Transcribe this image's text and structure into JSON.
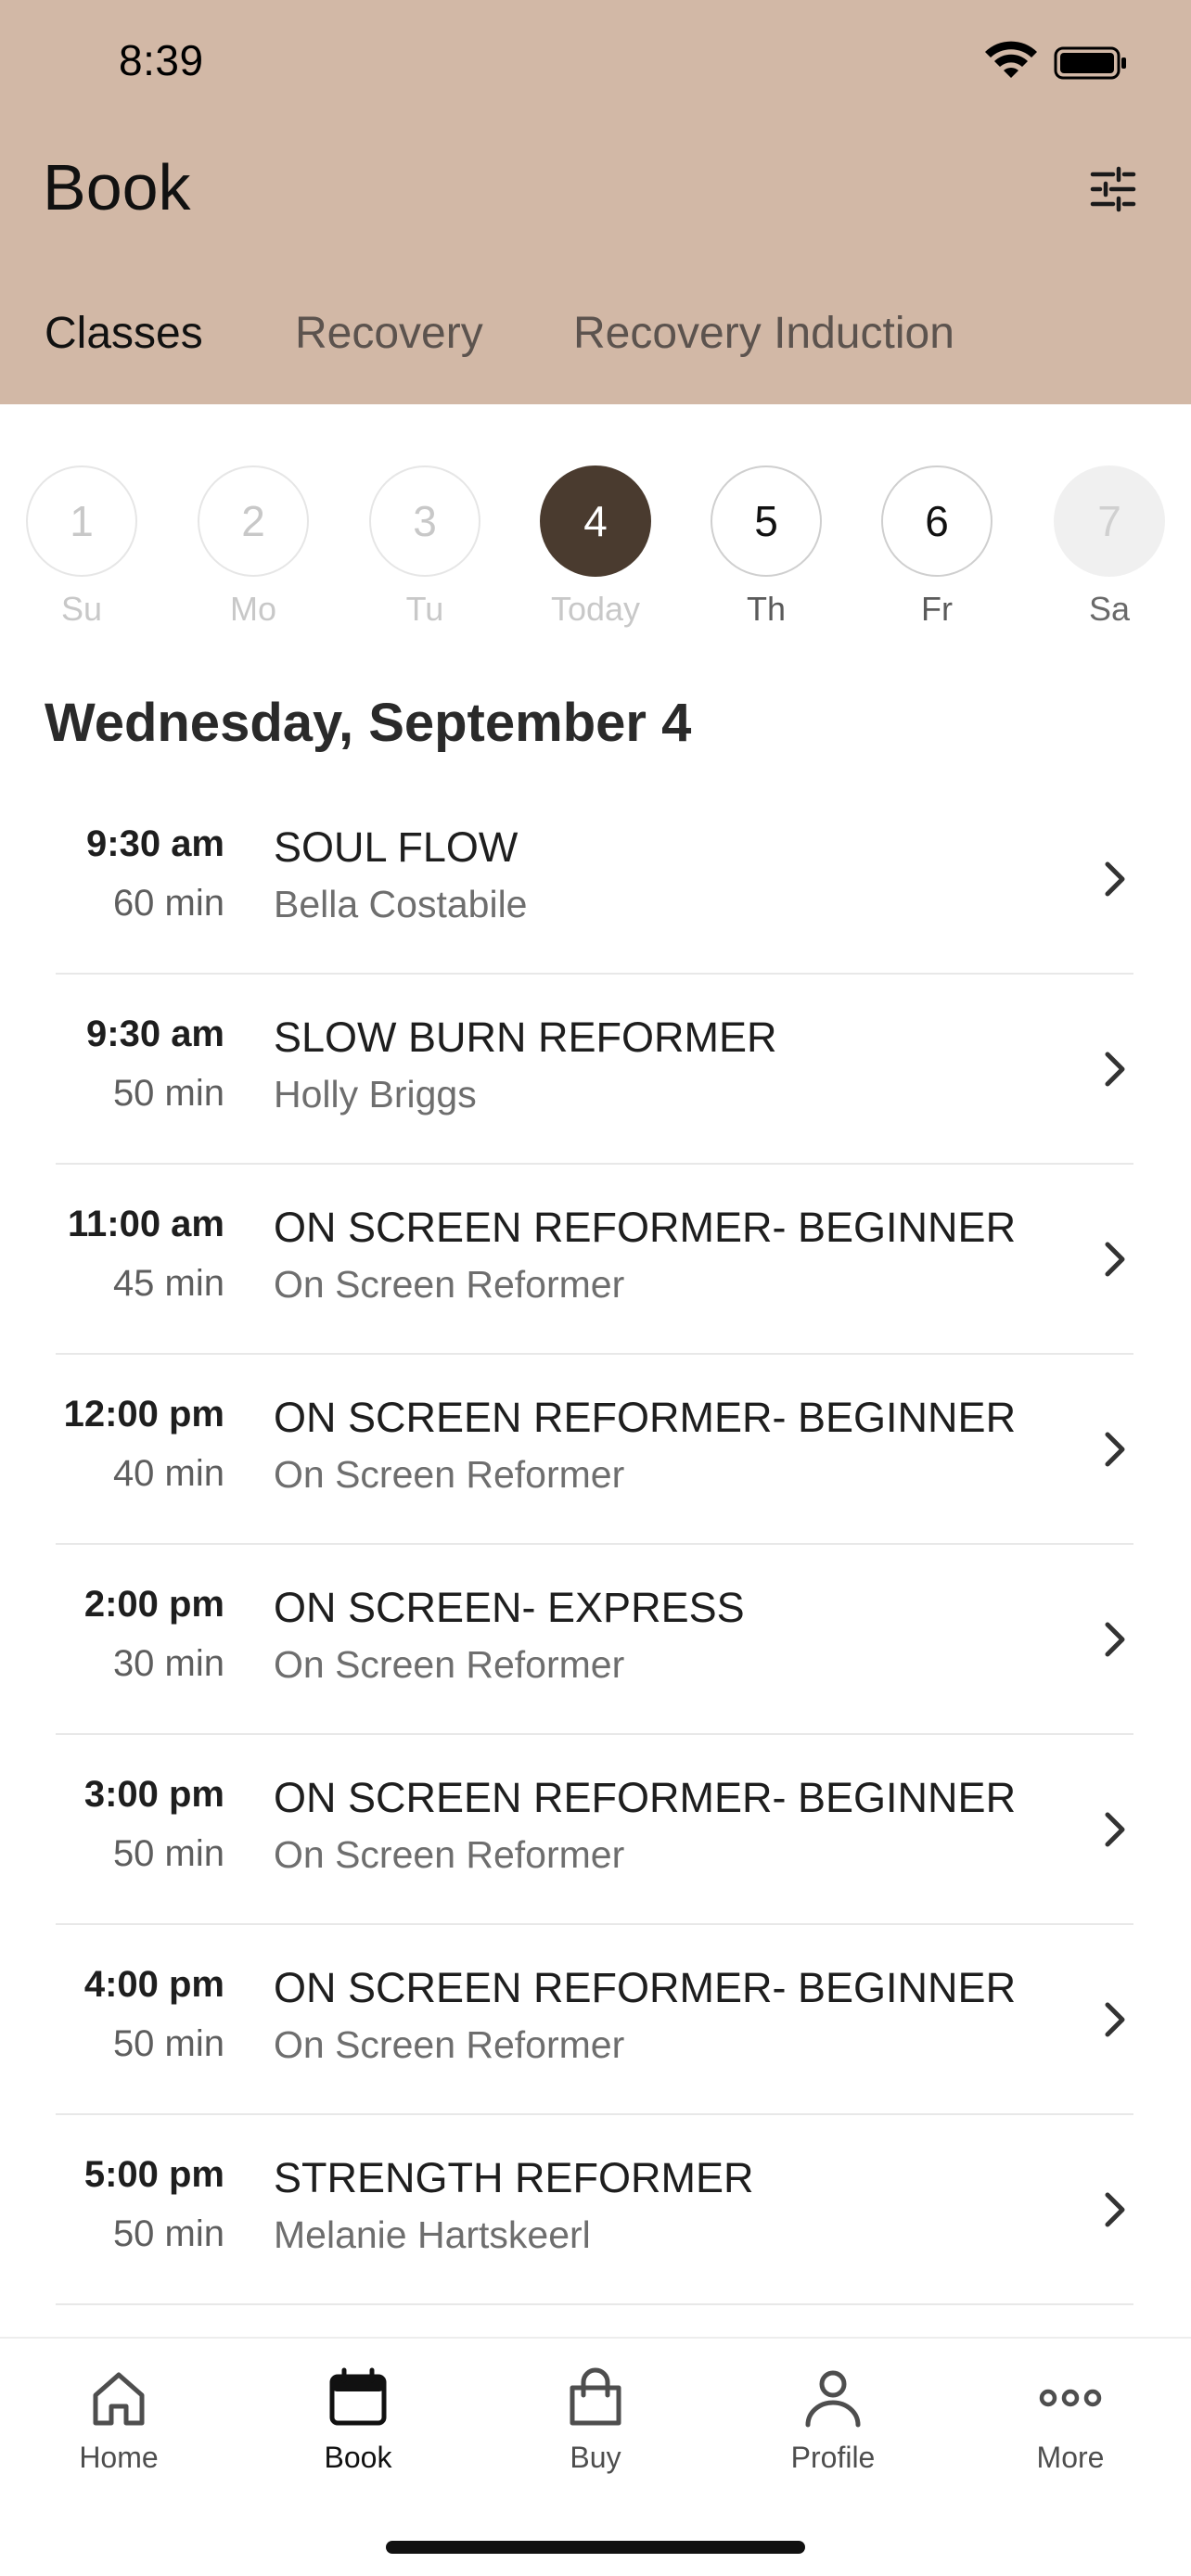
{
  "status_bar": {
    "time": "8:39"
  },
  "header": {
    "title": "Book",
    "filter_icon": "sliders-icon",
    "tabs": [
      {
        "label": "Classes",
        "active": true
      },
      {
        "label": "Recovery",
        "active": false
      },
      {
        "label": "Recovery Induction",
        "active": false
      }
    ]
  },
  "date_strip": {
    "days": [
      {
        "number": "1",
        "label": "Su",
        "state": "past"
      },
      {
        "number": "2",
        "label": "Mo",
        "state": "past"
      },
      {
        "number": "3",
        "label": "Tu",
        "state": "past"
      },
      {
        "number": "4",
        "label": "Today",
        "state": "selected"
      },
      {
        "number": "5",
        "label": "Th",
        "state": "upcoming"
      },
      {
        "number": "6",
        "label": "Fr",
        "state": "upcoming"
      },
      {
        "number": "7",
        "label": "Sa",
        "state": "disabled"
      }
    ]
  },
  "selected_date_heading": "Wednesday, September 4",
  "classes": [
    {
      "time": "9:30 am",
      "duration": "60 min",
      "name": "SOUL FLOW",
      "instructor": "Bella Costabile"
    },
    {
      "time": "9:30 am",
      "duration": "50 min",
      "name": "SLOW BURN REFORMER",
      "instructor": "Holly Briggs"
    },
    {
      "time": "11:00 am",
      "duration": "45 min",
      "name": "ON SCREEN REFORMER- BEGINNER",
      "instructor": "On Screen Reformer"
    },
    {
      "time": "12:00 pm",
      "duration": "40 min",
      "name": "ON SCREEN REFORMER- BEGINNER",
      "instructor": "On Screen Reformer"
    },
    {
      "time": "2:00 pm",
      "duration": "30 min",
      "name": "ON SCREEN- EXPRESS",
      "instructor": "On Screen Reformer"
    },
    {
      "time": "3:00 pm",
      "duration": "50 min",
      "name": "ON SCREEN REFORMER- BEGINNER",
      "instructor": "On Screen Reformer"
    },
    {
      "time": "4:00 pm",
      "duration": "50 min",
      "name": "ON SCREEN REFORMER- BEGINNER",
      "instructor": "On Screen Reformer"
    },
    {
      "time": "5:00 pm",
      "duration": "50 min",
      "name": "STRENGTH REFORMER",
      "instructor": "Melanie Hartskeerl"
    }
  ],
  "bottom_nav": [
    {
      "label": "Home",
      "icon": "home-icon",
      "active": false
    },
    {
      "label": "Book",
      "icon": "calendar-icon",
      "active": true
    },
    {
      "label": "Buy",
      "icon": "shopping-bag-icon",
      "active": false
    },
    {
      "label": "Profile",
      "icon": "person-icon",
      "active": false
    },
    {
      "label": "More",
      "icon": "more-dots-icon",
      "active": false
    }
  ],
  "colors": {
    "header_background": "#d2b8a6",
    "selected_day": "#4a3b2f",
    "text_primary": "#1e1e1e",
    "text_secondary": "#6e6e6e"
  }
}
